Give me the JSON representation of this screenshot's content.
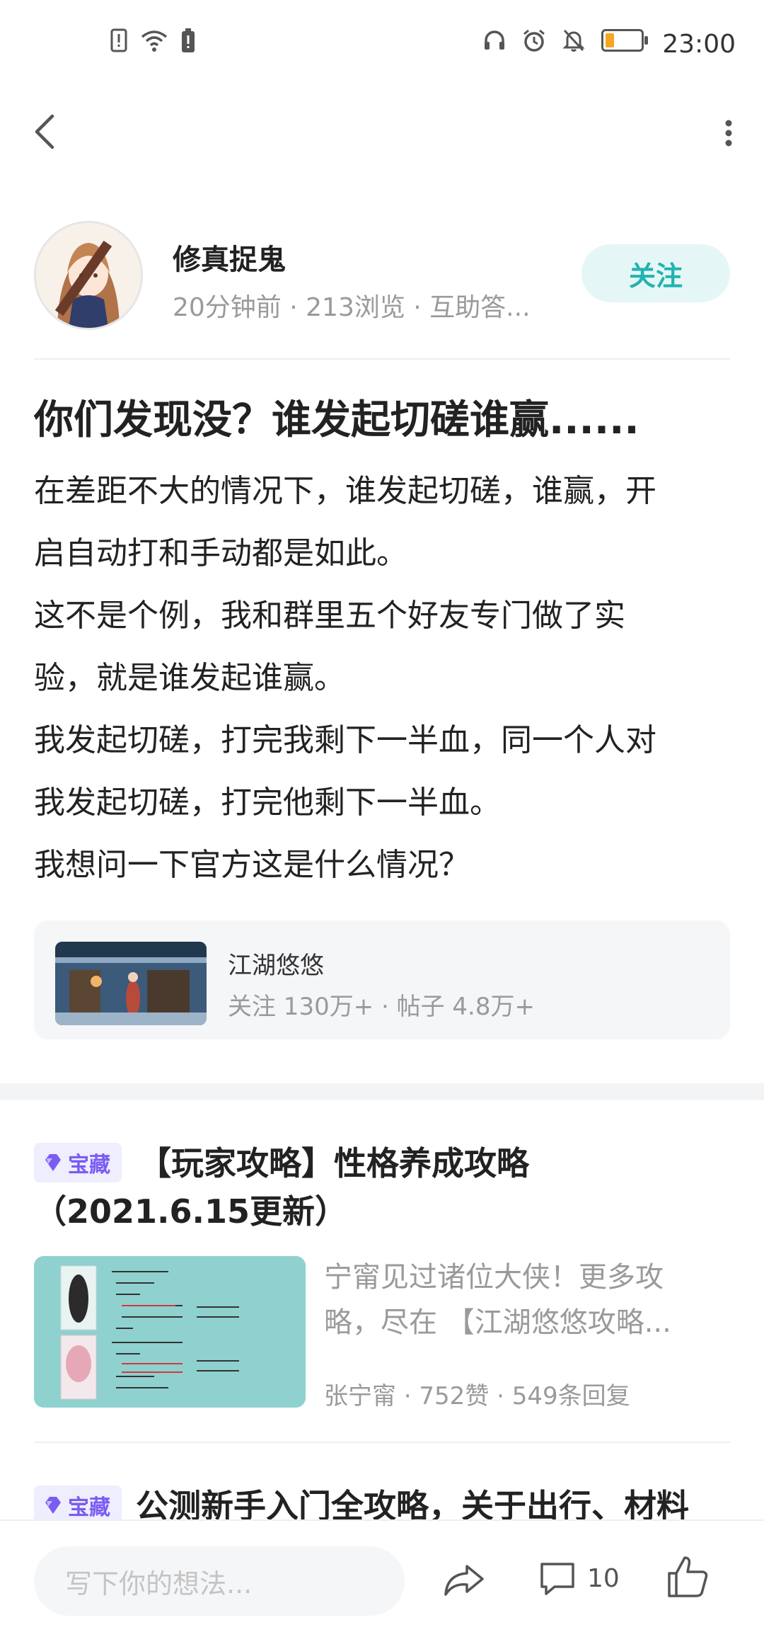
{
  "status_bar": {
    "time": "23:00",
    "left_icons": [
      "alert-icon",
      "wifi-icon",
      "battery-small-icon"
    ],
    "right_icons": [
      "headset-icon",
      "alarm-icon",
      "mute-icon",
      "battery-icon"
    ],
    "battery_level": 0.25,
    "battery_color": "#f5a623"
  },
  "nav": {
    "back_icon": "chevron-left-icon",
    "more_icon": "more-vertical-icon"
  },
  "author": {
    "name": "修真捉鬼",
    "meta": "20分钟前 · 213浏览 · 互助答...",
    "follow_label": "关注",
    "follow_color": "#22b2b0"
  },
  "post": {
    "title": "你们发现没？谁发起切磋谁赢......",
    "lines": [
      "在差距不大的情况下，谁发起切磋，谁赢，开",
      "启自动打和手动都是如此。",
      "这不是个例，我和群里五个好友专门做了实",
      "验，就是谁发起谁赢。",
      "我发起切磋，打完我剩下一半血，同一个人对",
      "我发起切磋，打完他剩下一半血。",
      "我想问一下官方这是什么情况？"
    ]
  },
  "forum": {
    "name": "江湖悠悠",
    "stats": "关注 130万+ · 帖子 4.8万+"
  },
  "recommendations": [
    {
      "badge": "宝藏",
      "title_line1": "【玩家攻略】性格养成攻略",
      "title_line2": "（2021.6.15更新）",
      "excerpt_line1": "宁甯见过诸位大侠！更多攻",
      "excerpt_line2": "略，尽在 【江湖悠悠攻略...",
      "meta": "张宁甯 · 752赞 · 549条回复"
    },
    {
      "badge": "宝藏",
      "title_line1": "公测新手入门全攻略，关于出行、材料"
    }
  ],
  "bottom_bar": {
    "input_placeholder": "写下你的想法...",
    "comment_count": "10",
    "share_icon": "share-icon",
    "comment_icon": "comment-icon",
    "like_icon": "thumbs-up-icon"
  }
}
